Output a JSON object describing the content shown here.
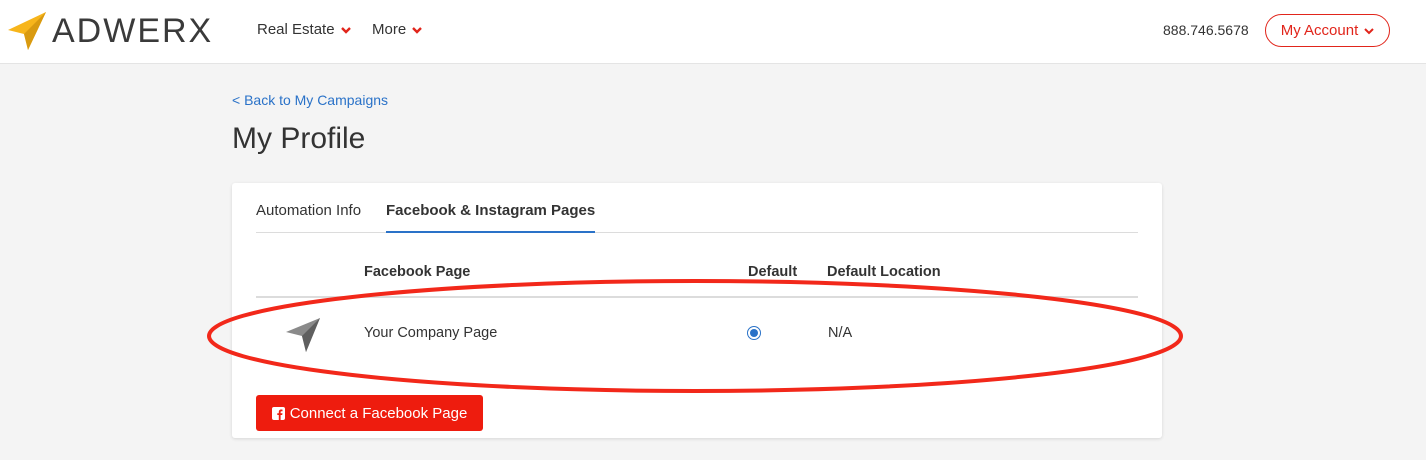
{
  "header": {
    "logo_text": "ADWERX",
    "logo_icon": "paper-plane-icon",
    "nav": [
      {
        "label": "Real Estate"
      },
      {
        "label": "More"
      }
    ],
    "phone": "888.746.5678",
    "account_label": "My Account"
  },
  "page": {
    "back_link": "< Back to My Campaigns",
    "title": "My Profile"
  },
  "tabs": [
    {
      "label": "Automation Info",
      "active": false
    },
    {
      "label": "Facebook & Instagram Pages",
      "active": true
    }
  ],
  "table": {
    "columns": [
      "Facebook Page",
      "Default",
      "Default Location"
    ],
    "rows": [
      {
        "icon": "location-arrow-icon",
        "page": "Your Company Page",
        "default": true,
        "location": "N/A"
      }
    ]
  },
  "connect_button": "Connect a Facebook Page",
  "colors": {
    "brand_red": "#e1251b",
    "link_blue": "#2a72c8",
    "logo_yellow": "#f7b51b",
    "annotation_red": "#f2281a"
  }
}
